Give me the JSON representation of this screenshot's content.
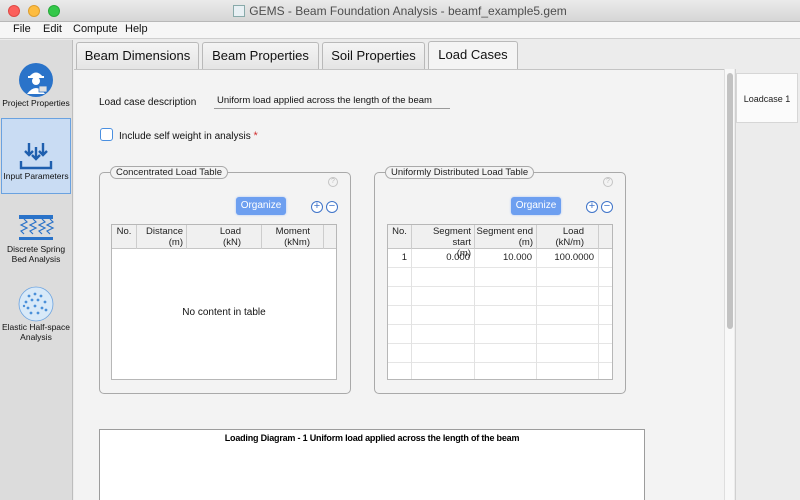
{
  "window": {
    "title": "GEMS - Beam Foundation Analysis - beamf_example5.gem"
  },
  "menu": {
    "items": [
      "File",
      "Edit",
      "Compute",
      "Help"
    ]
  },
  "sidebar": {
    "items": [
      {
        "label": "Project Properties",
        "icon": "engineer-icon"
      },
      {
        "label": "Input Parameters",
        "icon": "input-arrows-icon",
        "selected": true
      },
      {
        "label": "Discrete Spring Bed Analysis",
        "icon": "spring-bed-icon"
      },
      {
        "label": "Elastic Half-space Analysis",
        "icon": "half-space-icon"
      }
    ]
  },
  "tabs": [
    "Beam Dimensions",
    "Beam Properties",
    "Soil Properties",
    "Load Cases"
  ],
  "active_tab": "Load Cases",
  "form": {
    "description_label": "Load case description",
    "description_value": "Uniform load applied across the length of the beam",
    "self_weight_label": "Include self weight in analysis",
    "self_weight_checked": false,
    "required_marker": "*"
  },
  "concentrated": {
    "title": "Concentrated Load Table",
    "organize_label": "Organize",
    "add_symbol": "+",
    "remove_symbol": "−",
    "help_symbol": "?",
    "columns": [
      {
        "line1": "No.",
        "line2": ""
      },
      {
        "line1": "Distance",
        "line2": "(m)"
      },
      {
        "line1": "Load",
        "line2": "(kN)"
      },
      {
        "line1": "Moment",
        "line2": "(kNm)"
      }
    ],
    "empty_message": "No content in table"
  },
  "distributed": {
    "title": "Uniformly Distributed Load Table",
    "organize_label": "Organize",
    "add_symbol": "+",
    "remove_symbol": "−",
    "help_symbol": "?",
    "columns": [
      {
        "line1": "No.",
        "line2": ""
      },
      {
        "line1": "Segment start",
        "line2": "(m)"
      },
      {
        "line1": "Segment end",
        "line2": "(m)"
      },
      {
        "line1": "Load",
        "line2": "(kN/m)"
      }
    ],
    "rows": [
      [
        "1",
        "0.000",
        "10.000",
        "100.0000"
      ]
    ]
  },
  "diagram": {
    "title": "Loading Diagram - 1 Uniform load applied across the length of the beam"
  },
  "loadcases": {
    "items": [
      "Loadcase 1"
    ]
  },
  "colors": {
    "accent": "#6d9ff0",
    "selection": "#c9dcf3",
    "required": "#d03030"
  }
}
